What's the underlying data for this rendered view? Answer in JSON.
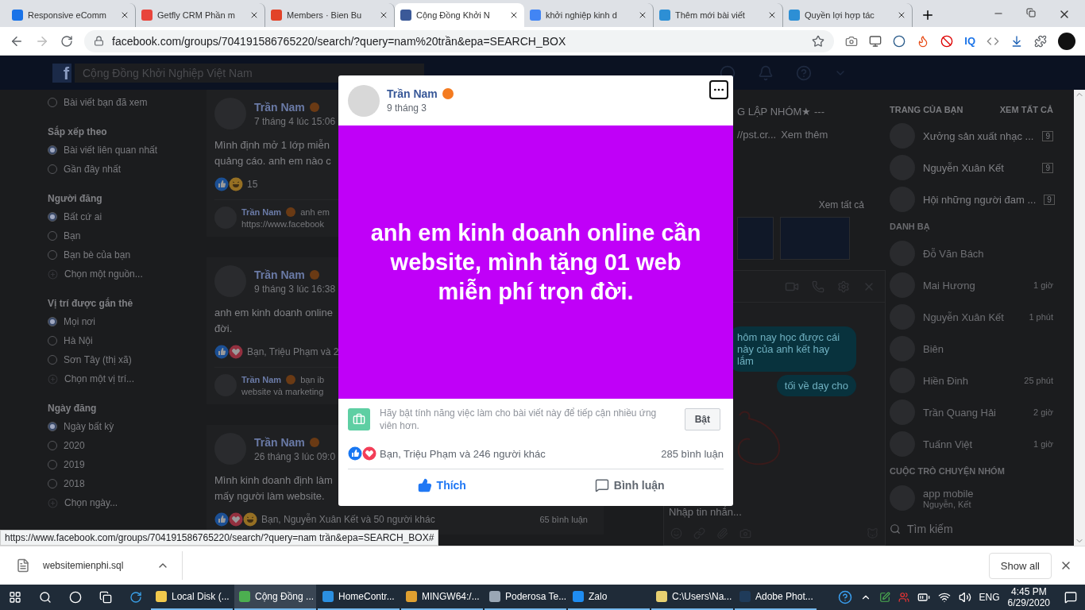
{
  "browser": {
    "tabs": [
      {
        "title": "Responsive eComm",
        "color": "#1a73e8",
        "selected": false
      },
      {
        "title": "Getfly CRM Phần m",
        "color": "#e8453c",
        "selected": false
      },
      {
        "title": "Members · Bien Bu",
        "color": "#e24329",
        "selected": false
      },
      {
        "title": "Cộng Đồng Khởi N",
        "color": "#3b5998",
        "selected": true
      },
      {
        "title": "khởi nghiệp kinh d",
        "color": "#4285f4",
        "selected": false
      },
      {
        "title": "Thêm mới bài viết",
        "color": "#2d8fd5",
        "selected": false
      },
      {
        "title": "Quyền lợi hợp tác",
        "color": "#2d8fd5",
        "selected": false
      }
    ],
    "address": "facebook.com/groups/704191586765220/search/?query=nam%20trần&epa=SEARCH_BOX",
    "extension_label": "IQ",
    "status_url": "https://www.facebook.com/groups/704191586765220/search/?query=nam trần&epa=SEARCH_BOX#"
  },
  "header": {
    "logo": "f",
    "search_value": "Cộng Đồng Khởi Nghiệp Việt Nam"
  },
  "filters": [
    {
      "options": [
        {
          "kind": "radio",
          "label": "Bài viết bạn đã xem",
          "selected": false
        }
      ]
    },
    {
      "heading": "Sắp xếp theo",
      "options": [
        {
          "kind": "radio",
          "label": "Bài viết liên quan nhất",
          "selected": true
        },
        {
          "kind": "radio",
          "label": "Gần đây nhất",
          "selected": false
        }
      ]
    },
    {
      "heading": "Người đăng",
      "options": [
        {
          "kind": "radio",
          "label": "Bất cứ ai",
          "selected": true
        },
        {
          "kind": "radio",
          "label": "Bạn",
          "selected": false
        },
        {
          "kind": "radio",
          "label": "Bạn bè của bạn",
          "selected": false
        },
        {
          "kind": "add",
          "label": "Chọn một nguồn..."
        }
      ]
    },
    {
      "heading": "Vị trí được gắn thẻ",
      "options": [
        {
          "kind": "radio",
          "label": "Mọi nơi",
          "selected": true
        },
        {
          "kind": "radio",
          "label": "Hà Nội",
          "selected": false
        },
        {
          "kind": "radio",
          "label": "Sơn Tây (thị xã)",
          "selected": false
        },
        {
          "kind": "add",
          "label": "Chọn một vị trí..."
        }
      ]
    },
    {
      "heading": "Ngày đăng",
      "options": [
        {
          "kind": "radio",
          "label": "Ngày bất kỳ",
          "selected": true
        },
        {
          "kind": "radio",
          "label": "2020",
          "selected": false
        },
        {
          "kind": "radio",
          "label": "2019",
          "selected": false
        },
        {
          "kind": "radio",
          "label": "2018",
          "selected": false
        },
        {
          "kind": "add",
          "label": "Chọn ngày..."
        }
      ]
    }
  ],
  "posts": [
    {
      "author": "Trần Nam",
      "time": "7 tháng 4 lúc 15:06",
      "lines": [
        "Mình định mở 1 lớp miễn",
        "quảng cáo. anh em nào c"
      ],
      "reactions": [
        {
          "kind": "like"
        },
        {
          "kind": "haha"
        }
      ],
      "reaction_text": "15",
      "comment": {
        "author": "Trần Nam",
        "text": "anh em",
        "link": "https://www.facebook"
      }
    },
    {
      "author": "Trần Nam",
      "time": "9 tháng 3 lúc 16:38",
      "lines": [
        "anh em kinh doanh online",
        "đời."
      ],
      "reactions": [
        {
          "kind": "like"
        },
        {
          "kind": "love"
        }
      ],
      "reaction_text": "Bạn, Triệu Phạm và 2",
      "comment": {
        "author": "Trần Nam",
        "text": "bạn ib",
        "link": "website và marketing"
      }
    },
    {
      "author": "Trần Nam",
      "time": "26 tháng 3 lúc 09:0",
      "lines": [
        "Mình kinh doanh định làm",
        "mấy người làm website."
      ],
      "reactions": [
        {
          "kind": "like"
        },
        {
          "kind": "love"
        },
        {
          "kind": "haha"
        }
      ],
      "reaction_text": "Bạn, Nguyễn Xuân Kết và 50 người khác",
      "comment_count": "65 bình luận"
    }
  ],
  "group_info": {
    "title": "G LẬP NHÓM★ ---",
    "link": "//pst.cr...",
    "more": "Xem thêm",
    "see_all": "Xem tất cả"
  },
  "chat": {
    "messages": [
      "hôm nay học được cái này của anh kết hay lắm",
      "tối về dạy cho"
    ],
    "placeholder": "Nhập tin nhắn..."
  },
  "contacts": {
    "pages_heading": "TRANG CỦA BẠN",
    "see_all": "XEM TẤT CẢ",
    "pages": [
      {
        "name": "Xưởng sản xuất nhạc ...",
        "badge": "9"
      },
      {
        "name": "Nguyễn Xuân Kết",
        "badge": "9"
      },
      {
        "name": "Hội những người đam ...",
        "badge": "9"
      }
    ],
    "people_heading": "DANH BẠ",
    "people": [
      {
        "name": "Đỗ Văn Bách"
      },
      {
        "name": "Mai Hương",
        "time": "1 giờ"
      },
      {
        "name": "Nguyễn Xuân Kết",
        "time": "1 phút"
      },
      {
        "name": "Biên"
      },
      {
        "name": "Hiền Đinh",
        "time": "25 phút"
      },
      {
        "name": "Trần Quang Hải",
        "time": "2 giờ"
      },
      {
        "name": "Tuấnn Việt",
        "time": "1 giờ"
      }
    ],
    "groups_heading": "CUỘC TRÒ CHUYỆN NHÓM",
    "groups": [
      {
        "name": "app mobile",
        "members": "Nguyễn, Kết"
      }
    ],
    "search_placeholder": "Tìm kiếm"
  },
  "modal": {
    "author": "Trần Nam",
    "date": "9 tháng 3",
    "text": "anh em kinh doanh online cần website, mình tặng 01 web miễn phí trọn đời.",
    "job_prompt": "Hãy bật tính năng việc làm cho bài viết này để tiếp cận nhiều ứng viên hơn.",
    "job_button": "Bật",
    "reactions": [
      {
        "kind": "like"
      },
      {
        "kind": "love"
      }
    ],
    "reaction_text": "Bạn, Triệu Phạm và 246 người khác",
    "comment_count": "285 bình luận",
    "like_label": "Thích",
    "liked": true,
    "comment_label": "Bình luận"
  },
  "downloads": {
    "file": "websitemienphi.sql",
    "show_all": "Show all"
  },
  "taskbar": {
    "items": [
      {
        "label": "Local Disk (...",
        "color": "#f2c94c",
        "selected": false
      },
      {
        "label": "Cộng Đồng ...",
        "color": "#4caf50",
        "selected": true
      },
      {
        "label": "HomeContr...",
        "color": "#2b8fe0",
        "selected": false
      },
      {
        "label": "MINGW64:/...",
        "color": "#e0a030",
        "selected": false
      },
      {
        "label": "Poderosa Te...",
        "color": "#9aa7b5",
        "selected": false
      },
      {
        "label": "Zalo",
        "color": "#1f8cf0",
        "selected": false
      },
      {
        "label": "C:\\Users\\Na...",
        "color": "#e8d070",
        "selected": false
      },
      {
        "label": "Adobe Phot...",
        "color": "#1f3b5a",
        "selected": false
      }
    ],
    "language": "ENG",
    "time": "4:45 PM",
    "date": "6/29/2020"
  }
}
